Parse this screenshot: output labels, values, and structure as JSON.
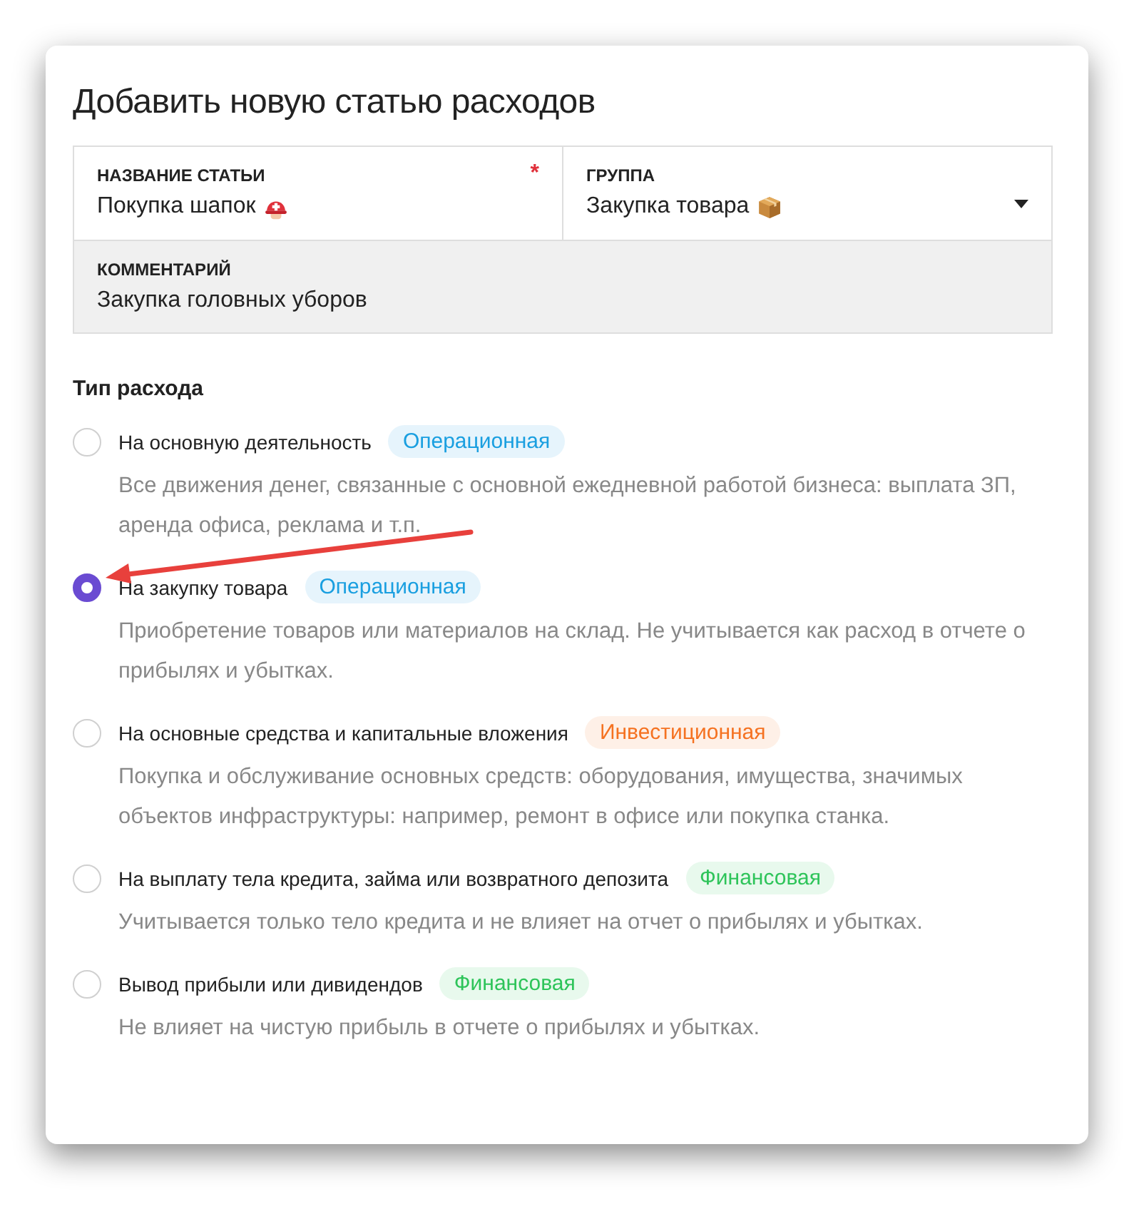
{
  "dialog": {
    "title": "Добавить новую статью расходов"
  },
  "fields": [
    {
      "label": "НАЗВАНИЕ СТАТЬИ",
      "value": "Покупка шапок",
      "required_mark": "*",
      "kind": "text"
    },
    {
      "label": "ГРУППА",
      "value": "Закупка товара",
      "kind": "select"
    },
    {
      "label": "КОММЕНТАРИЙ",
      "value": "Закупка головных уборов",
      "kind": "comment"
    }
  ],
  "section_title": "Тип расхода",
  "options": [
    {
      "label": "На основную деятельность",
      "selected": false,
      "tag": {
        "label": "Операционная",
        "color": "#1a9fe0"
      },
      "description": "Все движения денег, связанные с основной ежедневной работой бизнеса: выплата ЗП, аренда офиса, реклама и т.п."
    },
    {
      "label": "На закупку товара",
      "selected": true,
      "tag": {
        "label": "Операционная",
        "color": "#1a9fe0"
      },
      "description": "Приобретение товаров или материалов на склад. Не учитывается как расход в отчете о прибылях и убытках."
    },
    {
      "label": "На основные средства и капитальные вложения",
      "selected": false,
      "tag": {
        "label": "Инвестиционная",
        "color": "#f57221"
      },
      "description": "Покупка и обслуживание основных средств: оборудования, имущества, значимых объектов инфраструктуры: например, ремонт в офисе или покупка станка."
    },
    {
      "label": "На выплату тела кредита, займа или возвратного депозита",
      "selected": false,
      "tag": {
        "label": "Финансовая",
        "color": "#2ec45a"
      },
      "description": "Учитывается только тело кредита и не влияет на отчет о прибылях и убытках."
    },
    {
      "label": "Вывод прибыли или дивидендов",
      "selected": false,
      "tag": {
        "label": "Финансовая",
        "color": "#2ec45a"
      },
      "description": "Не влияет на чистую прибыль в отчете о прибылях и убытках."
    }
  ]
}
